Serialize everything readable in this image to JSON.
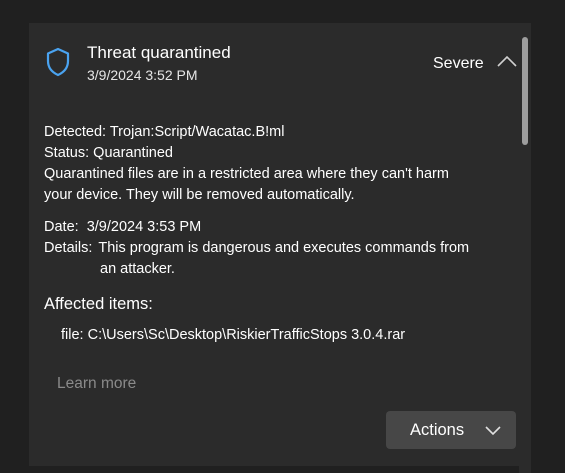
{
  "header": {
    "title": "Threat quarantined",
    "timestamp": "3/9/2024 3:52 PM",
    "severity": "Severe",
    "icon": "shield-icon",
    "collapse_icon": "chevron-up-icon"
  },
  "details": {
    "detected_label": "Detected:",
    "detected_value": "Trojan:Script/Wacatac.B!ml",
    "status_label": "Status:",
    "status_value": "Quarantined",
    "description_line1": "Quarantined files are in a restricted area where they can't harm",
    "description_line2": "your device. They will be removed automatically.",
    "date_label": "Date:",
    "date_value": "3/9/2024 3:53 PM",
    "details_label": "Details:",
    "details_line1": "This program is dangerous and executes commands from",
    "details_line2": "an attacker."
  },
  "affected": {
    "title": "Affected items:",
    "items": [
      {
        "prefix": "file:",
        "path": "C:\\Users\\Sc\\Desktop\\RiskierTrafficStops 3.0.4.rar"
      }
    ]
  },
  "links": {
    "learn_more": "Learn more"
  },
  "actions": {
    "label": "Actions",
    "chevron_icon": "chevron-down-icon"
  },
  "colors": {
    "background": "#202020",
    "panel": "#2b2b2b",
    "shield_accent": "#4aa3f0",
    "link_muted": "#8a8a8a",
    "button": "#474747"
  }
}
